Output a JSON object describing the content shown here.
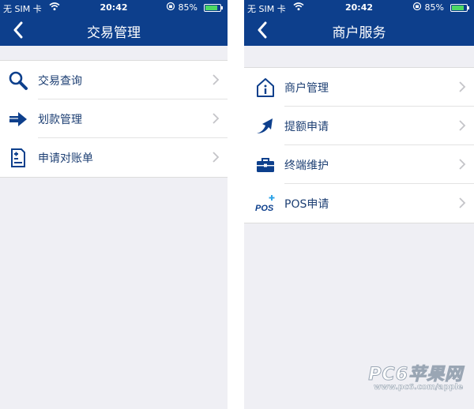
{
  "status_bar": {
    "carrier": "无 SIM 卡",
    "time": "20:42",
    "battery": "85%",
    "battery_level": 0.85
  },
  "left_screen": {
    "title": "交易管理",
    "items": [
      {
        "label": "交易查询",
        "icon": "search-icon"
      },
      {
        "label": "划款管理",
        "icon": "arrow-right-icon"
      },
      {
        "label": "申请对账单",
        "icon": "statement-icon"
      }
    ]
  },
  "right_screen": {
    "title": "商户服务",
    "items": [
      {
        "label": "商户管理",
        "icon": "info-house-icon"
      },
      {
        "label": "提额申请",
        "icon": "arrow-up-icon"
      },
      {
        "label": "终端维护",
        "icon": "toolbox-icon"
      },
      {
        "label": "POS申请",
        "icon": "pos-icon"
      }
    ]
  },
  "pos_icon_text": "POS",
  "watermark": {
    "title": "PC6苹果网",
    "url": "www.pc6.com/apple"
  },
  "colors": {
    "nav_bar": "#0d3f8c",
    "background": "#efeff4",
    "label": "#1d3f73",
    "icon": "#0d3f8c"
  }
}
